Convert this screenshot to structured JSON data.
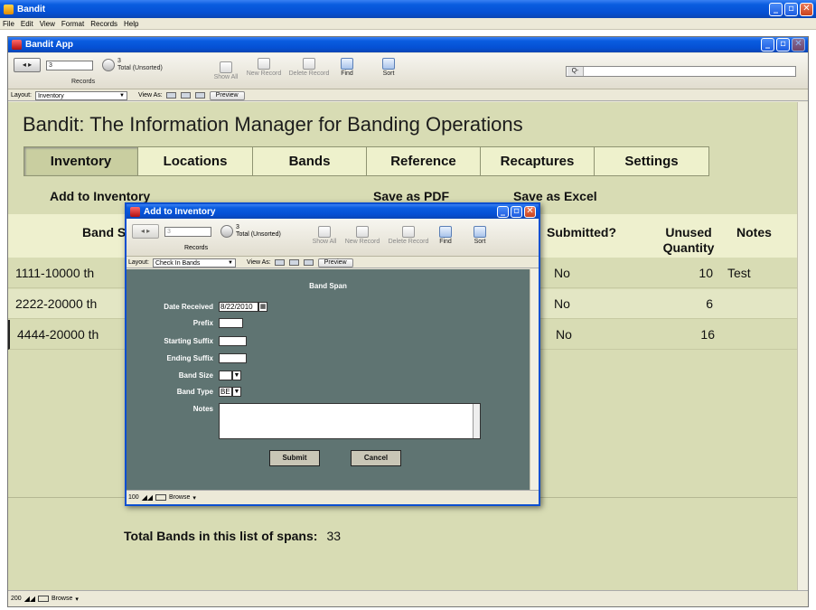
{
  "os_window": {
    "title": "Bandit"
  },
  "menubar": {
    "items": [
      "File",
      "Edit",
      "View",
      "Format",
      "Records",
      "Help"
    ]
  },
  "doc_window": {
    "title": "Bandit App",
    "toolbar": {
      "record_number": "3",
      "records_label": "Records",
      "total_count": "3",
      "total_status": "Total (Unsorted)",
      "show_all": "Show All",
      "new_record": "New Record",
      "delete_record": "Delete Record",
      "find": "Find",
      "sort": "Sort",
      "search_icon_text": "Q-"
    },
    "layout_label": "Layout:",
    "layout_value": "Inventory",
    "view_as_label": "View As:",
    "preview_label": "Preview",
    "status": {
      "zoom": "200",
      "mode": "Browse"
    }
  },
  "app": {
    "heading": "Bandit: The Information Manager for Banding Operations",
    "tabs": [
      {
        "label": "Inventory",
        "active": true
      },
      {
        "label": "Locations",
        "active": false
      },
      {
        "label": "Bands",
        "active": false
      },
      {
        "label": "Reference",
        "active": false
      },
      {
        "label": "Recaptures",
        "active": false
      },
      {
        "label": "Settings",
        "active": false
      }
    ],
    "actions": {
      "add": "Add to Inventory",
      "pdf": "Save as PDF",
      "excel": "Save as Excel"
    },
    "columns": {
      "band_span": "Band S",
      "submitted": "Submitted?",
      "unused_1": "Unused",
      "unused_2": "Quantity",
      "notes": "Notes"
    },
    "rows": [
      {
        "span": "1111-10000 th",
        "submitted": "No",
        "quantity": "10",
        "notes": "Test"
      },
      {
        "span": "2222-20000 th",
        "submitted": "No",
        "quantity": "6",
        "notes": ""
      },
      {
        "span": "4444-20000 th",
        "submitted": "No",
        "quantity": "16",
        "notes": ""
      }
    ],
    "total_label": "Total Bands in this list of spans:",
    "total_value": "33"
  },
  "dialog": {
    "title": "Add to Inventory",
    "toolbar": {
      "record_number": "3",
      "records_label": "Records",
      "total_count": "3",
      "total_status": "Total (Unsorted)",
      "show_all": "Show All",
      "new_record": "New Record",
      "delete_record": "Delete Record",
      "find": "Find",
      "sort": "Sort"
    },
    "layout_label": "Layout:",
    "layout_value": "Check In Bands",
    "view_as_label": "View As:",
    "preview_label": "Preview",
    "form": {
      "title": "Band Span",
      "date_received_label": "Date Received",
      "date_received_value": "8/22/2010",
      "prefix_label": "Prefix",
      "starting_suffix_label": "Starting Suffix",
      "ending_suffix_label": "Ending Suffix",
      "band_size_label": "Band Size",
      "band_type_label": "Band Type",
      "band_type_value": "BE",
      "notes_label": "Notes",
      "submit_label": "Submit",
      "cancel_label": "Cancel"
    },
    "status": {
      "zoom": "100",
      "mode": "Browse"
    }
  }
}
